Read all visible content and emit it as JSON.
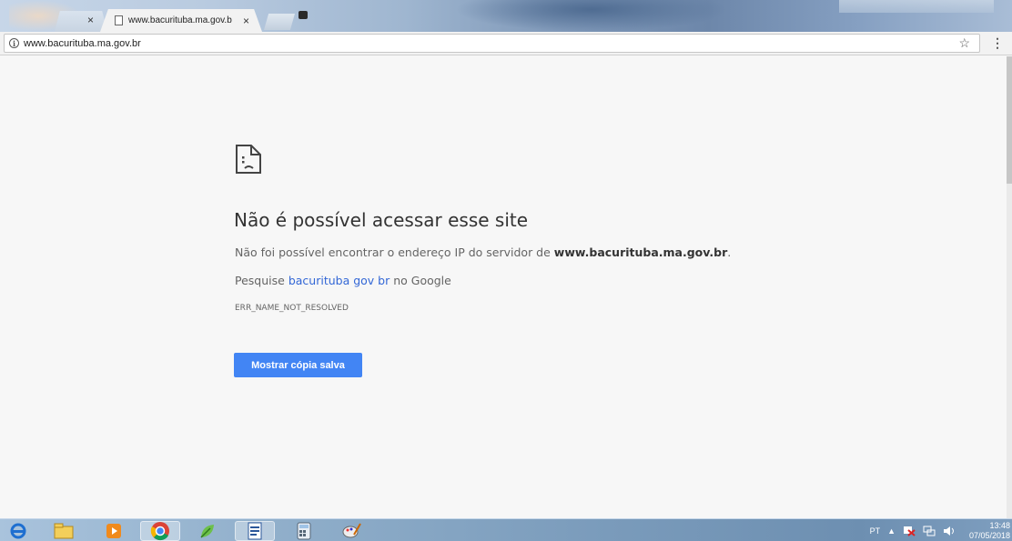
{
  "browser": {
    "inactive_tab_close": "×",
    "tab": {
      "title": "www.bacurituba.ma.gov.b",
      "close": "×"
    },
    "address": {
      "url": "www.bacurituba.ma.gov.br",
      "info_glyph": "i"
    },
    "star_glyph": "☆",
    "menu_glyph": "⋮"
  },
  "error_page": {
    "title": "Não é possível acessar esse site",
    "dns_prefix": "Não foi possível encontrar o endereço IP do servidor de ",
    "dns_host": "www.bacurituba.ma.gov.br",
    "dns_suffix": ".",
    "search_prefix": "Pesquise ",
    "search_link": "bacurituba gov br",
    "search_suffix": " no Google",
    "error_code": "ERR_NAME_NOT_RESOLVED",
    "button_label": "Mostrar cópia salva",
    "colors": {
      "button": "#4285f4",
      "link": "#3367d6"
    }
  },
  "taskbar": {
    "apps": [
      "internet-explorer-icon",
      "file-explorer-icon",
      "media-player-icon",
      "chrome-icon",
      "leaf-app-icon",
      "document-editor-icon",
      "calculator-icon",
      "paint-icon"
    ],
    "language": "PT",
    "tray_arrow": "▲",
    "clock_time": "13:48",
    "clock_date": "07/05/2018"
  }
}
